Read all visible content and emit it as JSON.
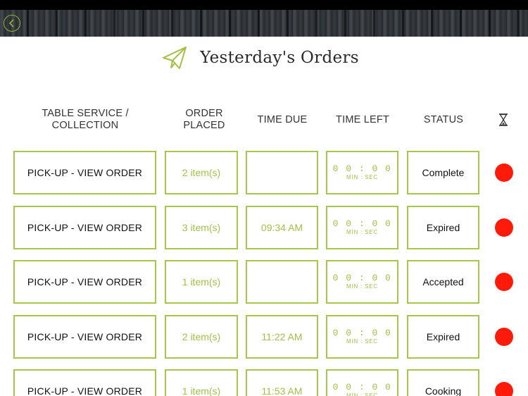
{
  "header": {
    "title": "Yesterday's Orders",
    "back_icon": "chevron-left-icon",
    "title_icon": "paper-plane-icon"
  },
  "columns": {
    "service": "TABLE SERVICE / COLLECTION",
    "placed": "ORDER PLACED",
    "due": "TIME DUE",
    "left": "TIME LEFT",
    "status": "STATUS",
    "timer_icon": "hourglass-icon"
  },
  "colors": {
    "accent": "#a3c045",
    "indicator": "#ff1a0a"
  },
  "orders": [
    {
      "service": "PICK-UP - VIEW ORDER",
      "items": "2 item(s)",
      "due": "",
      "time_left": "00:00",
      "time_unit": "MIN : SEC",
      "status": "Complete"
    },
    {
      "service": "PICK-UP - VIEW ORDER",
      "items": "3 item(s)",
      "due": "09:34 AM",
      "time_left": "00:00",
      "time_unit": "MIN : SEC",
      "status": "Expired"
    },
    {
      "service": "PICK-UP - VIEW ORDER",
      "items": "1 item(s)",
      "due": "",
      "time_left": "00:00",
      "time_unit": "MIN : SEC",
      "status": "Accepted"
    },
    {
      "service": "PICK-UP - VIEW ORDER",
      "items": "2 item(s)",
      "due": "11:22 AM",
      "time_left": "00:00",
      "time_unit": "MIN : SEC",
      "status": "Expired"
    },
    {
      "service": "PICK-UP - VIEW ORDER",
      "items": "1 item(s)",
      "due": "11:53 AM",
      "time_left": "00:00",
      "time_unit": "MIN : SEC",
      "status": "Cooking"
    }
  ]
}
